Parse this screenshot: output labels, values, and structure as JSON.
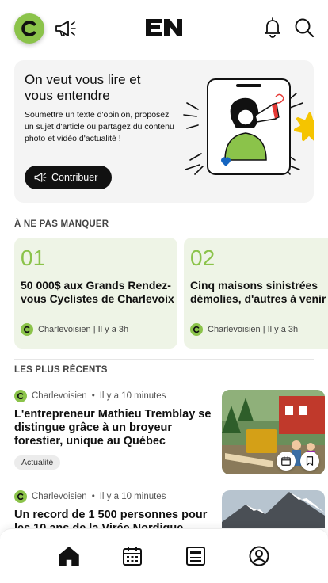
{
  "header": {
    "logo_text": "EN",
    "icons": [
      "charlevoisien-logo-icon",
      "megaphone-icon",
      "bell-icon",
      "search-icon"
    ]
  },
  "hero": {
    "title": "On veut vous lire et vous entendre",
    "text": "Soumettre un texte d'opinion, proposez un sujet d'article ou partagez du contenu photo et vidéo d'actualité !",
    "button_label": "Contribuer"
  },
  "sections": {
    "must_read": "À NE PAS MANQUER",
    "latest": "LES PLUS RÉCENTS"
  },
  "carousel": [
    {
      "number": "01",
      "title": "50 000$ aux Grands Rendez-vous Cyclistes de Charlevoix",
      "source": "Charlevoisien | Il y a 3h"
    },
    {
      "number": "02",
      "title": "Cinq maisons sinistrées démolies, d'autres à venir",
      "source": "Charlevoisien | Il y a 3h"
    }
  ],
  "articles": [
    {
      "source": "Charlevoisien",
      "time": "Il y a 10 minutes",
      "title": "L'entrepreneur Mathieu Tremblay se distingue grâce à un broyeur forestier, unique au Québec",
      "tag": "Actualité"
    },
    {
      "source": "Charlevoisien",
      "time": "Il y a 10 minutes",
      "title": "Un record de 1 500 personnes pour les 10 ans de la Virée Nordique",
      "tag": ""
    }
  ],
  "nav": [
    "home-icon",
    "calendar-icon",
    "newspaper-icon",
    "profile-icon"
  ],
  "colors": {
    "brand_green": "#8bc34a",
    "card_green": "#eef4e6",
    "hero_bg": "#f4f4f4",
    "star_yellow": "#f5c400",
    "dark": "#111111"
  }
}
